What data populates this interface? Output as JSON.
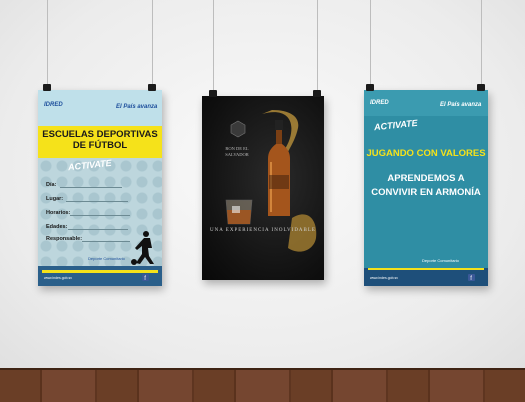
{
  "poster_left": {
    "logo_left": "IDRED",
    "logo_right": "El País avanza",
    "title": "ESCUELAS DEPORTIVAS DE FÚTBOL",
    "brand": "ACTIVATE",
    "fields": [
      "Día:",
      "Lugar:",
      "Horarios:",
      "Edades:",
      "Responsable:"
    ],
    "footer_logo": "Deporte Comunitario",
    "footer_web": "www.indes.gob.sv"
  },
  "poster_center": {
    "brand": "RON DE EL SALVADOR",
    "tagline": "UNA EXPERIENCIA INOLVIDABLE"
  },
  "poster_right": {
    "logo_left": "IDRED",
    "logo_right": "El País avanza",
    "brand": "ACTIVATE",
    "headline": "JUGANDO CON VALORES",
    "body": "APRENDEMOS A CONVIVIR EN ARMONÍA",
    "footer_logo": "Deporte Comunitario",
    "footer_web": "www.indes.gob.sv"
  },
  "colors": {
    "yellow": "#f5e21a",
    "blue": "#1e4f9c",
    "teal": "#2f8ea4",
    "dark": "#111111"
  },
  "icons": [
    "clip-icon",
    "soccer-player-icon",
    "facebook-icon",
    "bottle-icon",
    "glass-icon"
  ]
}
